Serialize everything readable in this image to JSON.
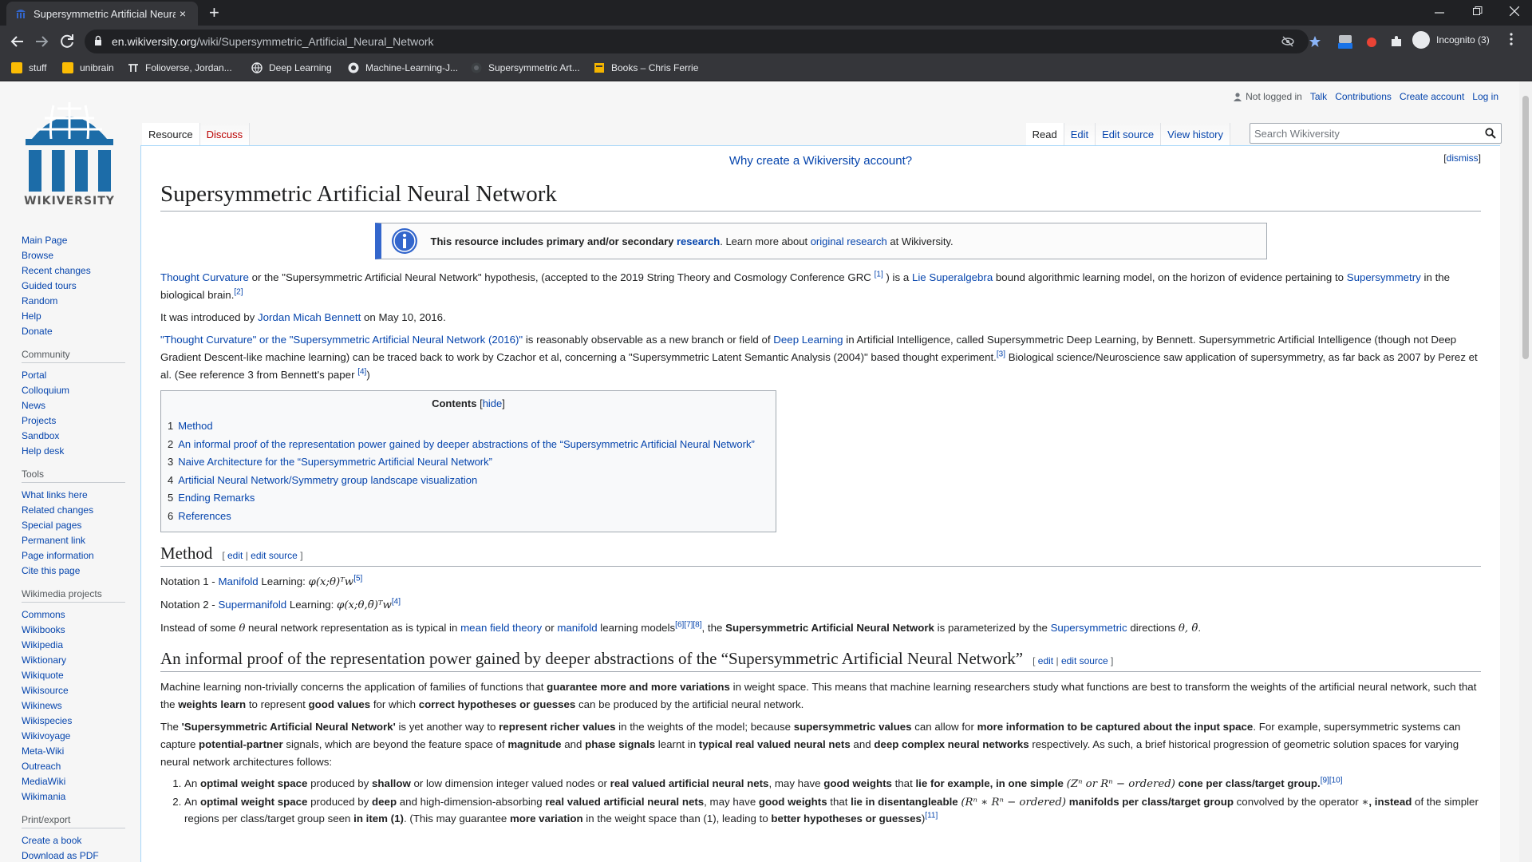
{
  "browser": {
    "tab_title": "Supersymmetric Artificial Neural",
    "tab_close": "×",
    "new_tab": "+",
    "url_host": "en.wikiversity.org",
    "url_path": "/wiki/Supersymmetric_Artificial_Neural_Network",
    "profile_label": "Incognito (3)",
    "bookmarks": [
      "stuff",
      "unibrain",
      "Folioverse, Jordan...",
      "Deep Learning",
      "Machine-Learning-J...",
      "Supersymmetric Art...",
      "Books – Chris Ferrie"
    ]
  },
  "logo": {
    "wordmark": "WIKIVERSITY"
  },
  "sidebar": {
    "main": [
      "Main Page",
      "Browse",
      "Recent changes",
      "Guided tours",
      "Random",
      "Help",
      "Donate"
    ],
    "community_heading": "Community",
    "community": [
      "Portal",
      "Colloquium",
      "News",
      "Projects",
      "Sandbox",
      "Help desk"
    ],
    "tools_heading": "Tools",
    "tools": [
      "What links here",
      "Related changes",
      "Special pages",
      "Permanent link",
      "Page information",
      "Cite this page"
    ],
    "projects_heading": "Wikimedia projects",
    "projects": [
      "Commons",
      "Wikibooks",
      "Wikipedia",
      "Wiktionary",
      "Wikiquote",
      "Wikisource",
      "Wikinews",
      "Wikispecies",
      "Wikivoyage",
      "Meta-Wiki",
      "Outreach",
      "MediaWiki",
      "Wikimania"
    ],
    "print_heading": "Print/export",
    "print": [
      "Create a book",
      "Download as PDF"
    ]
  },
  "usernav": {
    "not_logged_in": "Not logged in",
    "talk": "Talk",
    "contributions": "Contributions",
    "create_account": "Create account",
    "login": "Log in"
  },
  "tabs": {
    "resource": "Resource",
    "discuss": "Discuss",
    "read": "Read",
    "edit": "Edit",
    "edit_source": "Edit source",
    "view_history": "View history"
  },
  "search": {
    "placeholder": "Search Wikiversity"
  },
  "notice": {
    "why": "Why create a Wikiversity account?",
    "dismiss": "dismiss"
  },
  "article": {
    "title": "Supersymmetric Artificial Neural Network",
    "ambox": {
      "bold": "This resource includes primary and/or secondary ",
      "research": "research",
      "mid": ". Learn more about ",
      "original": "original research",
      "end": " at Wikiversity."
    },
    "p1": {
      "a": "Thought Curvature",
      "b": " or the \"Supersymmetric Artificial Neural Network\" hypothesis, (accepted to the 2019 String Theory and Cosmology Conference GRC ",
      "r1": "[1]",
      "c": " ) is a ",
      "d": "Lie Superalgebra",
      "e": " bound algorithmic learning model, on the horizon of evidence pertaining to ",
      "f": "Supersymmetry",
      "g": " in the biological brain.",
      "r2": "[2]"
    },
    "p2": {
      "a": "It was introduced by ",
      "b": "Jordan Micah Bennett",
      "c": " on May 10, 2016."
    },
    "p3": {
      "a": "\"Thought Curvature\" or the \"Supersymmetric Artificial Neural Network (2016)\"",
      "b": " is reasonably observable as a new branch or field of ",
      "c": "Deep Learning",
      "d": " in Artificial Intelligence, called Supersymmetric Deep Learning, by Bennett. Supersymmetric Artificial Intelligence (though not Deep Gradient Descent-like machine learning) can be traced back to work by Czachor et al, concerning a \"Supersymmetric Latent Semantic Analysis (2004)\" based thought experiment.",
      "r3": "[3]",
      "e": " Biological science/Neuroscience saw application of supersymmetry, as far back as 2007 by Perez et al. (See reference 3 from Bennett's paper ",
      "r4": "[4]",
      "f": ")"
    },
    "toc": {
      "title": "Contents",
      "hide": "hide",
      "items": [
        {
          "num": "1",
          "text": "Method"
        },
        {
          "num": "2",
          "text": "An informal proof of the representation power gained by deeper abstractions of the “Supersymmetric Artificial Neural Network”"
        },
        {
          "num": "3",
          "text": "Naive Architecture for the “Supersymmetric Artificial Neural Network”"
        },
        {
          "num": "4",
          "text": "Artificial Neural Network/Symmetry group landscape visualization"
        },
        {
          "num": "5",
          "text": "Ending Remarks"
        },
        {
          "num": "6",
          "text": "References"
        }
      ]
    },
    "edit_links": {
      "edit": "edit",
      "edit_source": "edit source"
    },
    "method": {
      "heading": "Method",
      "n1_pre": "Notation 1 - ",
      "n1_link": "Manifold",
      "n1_post": " Learning: ",
      "n1_math": "φ(x;θ)ᵀw",
      "n1_ref": "[5]",
      "n2_pre": "Notation 2 - ",
      "n2_link": "Supermanifold",
      "n2_post": " Learning: ",
      "n2_math": "φ(x;θ,θ̄)ᵀw",
      "n2_ref": "[4]",
      "p_a": "Instead of some ",
      "p_theta": "θ",
      "p_b": " neural network representation as is typical in ",
      "p_mft": "mean field theory",
      "p_or": " or ",
      "p_manifold": "manifold",
      "p_c": " learning models",
      "p_refs": "[6][7][8]",
      "p_d": ", the ",
      "p_bold": "Supersymmetric Artificial Neural Network",
      "p_e": " is parameterized by the ",
      "p_susy": "Supersymmetric",
      "p_f": " directions ",
      "p_dirs": "θ, θ̄",
      "p_g": "."
    },
    "proof": {
      "heading": "An informal proof of the representation power gained by deeper abstractions of the “Supersymmetric Artificial Neural Network”",
      "p1_a": "Machine learning non-trivially concerns the application of families of functions that ",
      "p1_b": "guarantee more and more variations",
      "p1_c": " in weight space. This means that machine learning researchers study what functions are best to transform the weights of the artificial neural network, such that the ",
      "p1_d": "weights learn",
      "p1_e": " to represent ",
      "p1_f": "good values",
      "p1_g": " for which ",
      "p1_h": "correct hypotheses or guesses",
      "p1_i": " can be produced by the artificial neural network.",
      "p2_a": "The ",
      "p2_b": "'Supersymmetric Artificial Neural Network'",
      "p2_c": " is yet another way to ",
      "p2_d": "represent richer values",
      "p2_e": " in the weights of the model; because ",
      "p2_f": "supersymmetric values",
      "p2_g": " can allow for ",
      "p2_h": "more information to be captured about the input space",
      "p2_i": ". For example, supersymmetric systems can capture ",
      "p2_j": "potential-partner",
      "p2_k": " signals, which are beyond the feature space of ",
      "p2_l": "magnitude",
      "p2_m": " and ",
      "p2_n": "phase signals",
      "p2_o": " learnt in ",
      "p2_p": "typical real valued neural nets",
      "p2_q": " and ",
      "p2_r": "deep complex neural networks",
      "p2_s": " respectively. As such, a brief historical progression of geometric solution spaces for varying neural network architectures follows:",
      "li1_a": "An ",
      "li1_b": "optimal weight space",
      "li1_c": " produced by ",
      "li1_d": "shallow",
      "li1_e": " or low dimension integer valued nodes or ",
      "li1_f": "real valued artificial neural nets",
      "li1_g": ", may have ",
      "li1_h": "good weights",
      "li1_i": " that ",
      "li1_j": "lie for example, in one simple ",
      "li1_math": "(Zⁿ or Rⁿ − ordered)",
      "li1_k": " cone per class/target group.",
      "li1_ref": "[9][10]",
      "li2_a": "An ",
      "li2_b": "optimal weight space",
      "li2_c": " produced by ",
      "li2_d": "deep",
      "li2_e": " and high-dimension-absorbing ",
      "li2_f": "real valued artificial neural nets",
      "li2_g": ", may have ",
      "li2_h": "good weights",
      "li2_i": " that ",
      "li2_j": "lie in disentangleable ",
      "li2_math": "(Rⁿ ∗ Rⁿ − ordered)",
      "li2_k": " manifolds per class/target group",
      "li2_l": " convolved by the operator ",
      "li2_op": "∗",
      "li2_m": ", instead",
      "li2_n": " of the simpler regions per class/target group seen ",
      "li2_o": "in item (1)",
      "li2_p": ". (This may guarantee ",
      "li2_q": "more variation",
      "li2_r": " in the weight space than (1), leading to ",
      "li2_s": "better hypotheses or guesses",
      "li2_t": ")",
      "li2_ref": "[11]"
    }
  }
}
